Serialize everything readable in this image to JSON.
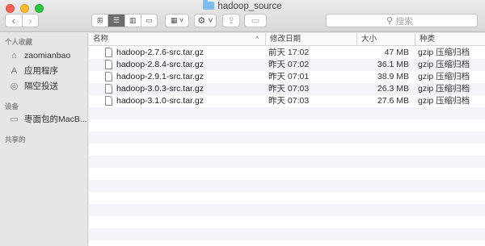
{
  "window": {
    "title": "hadoop_source",
    "folder_icon": "folder-icon"
  },
  "toolbar": {
    "back_icon": "‹",
    "forward_icon": "›",
    "view_icons": [
      "⊞",
      "☰",
      "▥",
      "▭"
    ],
    "arrange_icon": "▦ ˅",
    "action_icon": "⚙ ˅",
    "share_icon": "⇪",
    "tag_icon": "▭",
    "search_placeholder": "搜索"
  },
  "sidebar": {
    "favorites_header": "个人收藏",
    "favorites": [
      {
        "label": "zaomianbao",
        "icon": "⌂",
        "icon_name": "home-icon"
      },
      {
        "label": "应用程序",
        "icon": "A",
        "icon_name": "applications-icon"
      },
      {
        "label": "隔空投送",
        "icon": "◎",
        "icon_name": "airdrop-icon"
      }
    ],
    "devices_header": "设备",
    "devices": [
      {
        "label": "枣面包的MacB...",
        "icon": "▭",
        "icon_name": "laptop-icon"
      }
    ],
    "shared_header": "共享的"
  },
  "columns": {
    "name": "名称",
    "date": "修改日期",
    "size": "大小",
    "kind": "种类",
    "sort_caret": "^"
  },
  "files": [
    {
      "name": "hadoop-2.7.6-src.tar.gz",
      "date": "前天 17:02",
      "size": "47 MB",
      "kind": "gzip 压缩归档"
    },
    {
      "name": "hadoop-2.8.4-src.tar.gz",
      "date": "昨天 07:02",
      "size": "36.1 MB",
      "kind": "gzip 压缩归档"
    },
    {
      "name": "hadoop-2.9.1-src.tar.gz",
      "date": "昨天 07:01",
      "size": "38.9 MB",
      "kind": "gzip 压缩归档"
    },
    {
      "name": "hadoop-3.0.3-src.tar.gz",
      "date": "昨天 07:03",
      "size": "26.3 MB",
      "kind": "gzip 压缩归档"
    },
    {
      "name": "hadoop-3.1.0-src.tar.gz",
      "date": "昨天 07:03",
      "size": "27.6 MB",
      "kind": "gzip 压缩归档"
    }
  ]
}
